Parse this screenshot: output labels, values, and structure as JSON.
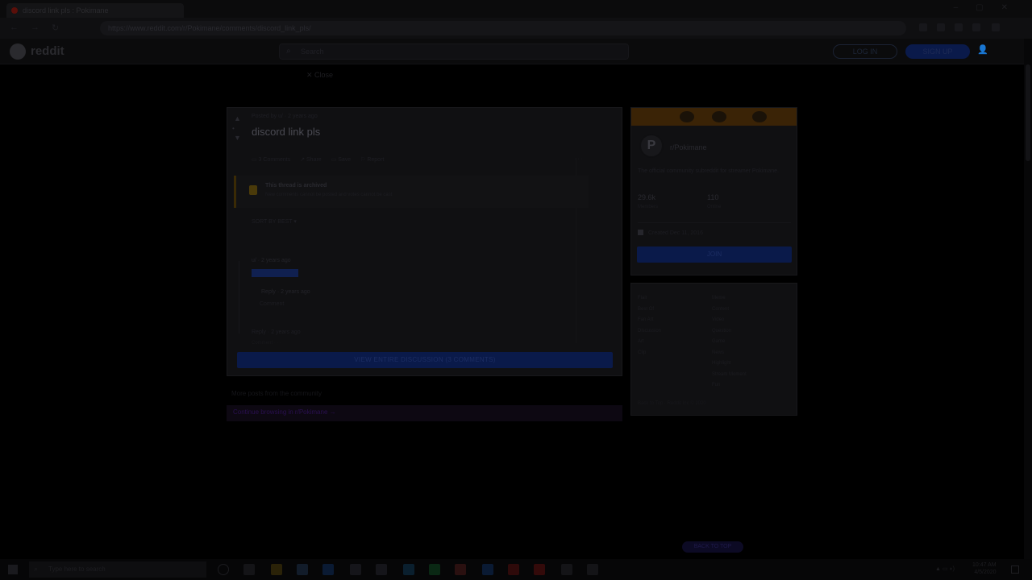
{
  "browser": {
    "tab_title": "discord link pls : Pokimane",
    "url": "https://www.reddit.com/r/Pokimane/comments/discord_link_pls/",
    "nav_back": "←",
    "nav_forward": "→",
    "nav_reload": "↻",
    "window_controls": "–▢✕"
  },
  "header": {
    "logo_text": "reddit",
    "search_placeholder": "Search",
    "login_label": "LOG IN",
    "signup_label": "SIGN UP",
    "user_icon": "👤"
  },
  "close_label": "✕ Close",
  "post": {
    "vote_up": "▲",
    "vote_count": "•",
    "vote_down": "▼",
    "meta": "Posted by u/ · 2 years ago",
    "title": "discord link pls",
    "actions": [
      "▭ 3 Comments",
      "↗ Share",
      "▭ Save",
      "⚐ Report"
    ],
    "sort_hint": "· · ·",
    "lock_title": "This thread is archived",
    "lock_sub": "New comments cannot be posted and votes cannot be cast",
    "sort_by": "SORT BY  BEST ▾",
    "comment1_author": "u/ · 2 years ago",
    "comment2_author": "Reply  · 2 years ago",
    "comment2_text": "Comment",
    "comment3_author": "Reply · 2 years ago",
    "comment3_sub": "Comment · · ·",
    "view_button": "VIEW ENTIRE DISCUSSION (3 COMMENTS)"
  },
  "more_label": "More posts from the community",
  "see_more_label": "Continue browsing in r/Pokimane →",
  "community": {
    "avatar_letter": "P",
    "name": "r/Pokimane",
    "description": "The official community subreddit for streamer Pokimane.",
    "members_value": "29.6k",
    "members_label": "Members",
    "online_value": "110",
    "online_label": "Online",
    "created": "Created Dec 11, 2016",
    "join_label": "JOIN"
  },
  "flair": {
    "col1": [
      "Flair",
      "Best Of",
      "Fan Art",
      "Discussion",
      "Art",
      "Clip"
    ],
    "col2": [
      "Meme",
      "Content",
      "Video",
      "Question",
      "Game",
      "News",
      "Highlight",
      "Stream Moment",
      "Fun"
    ],
    "footer": "Back to Top · Reddit Inc © 2020"
  },
  "back_to_top": "BACK TO TOP",
  "taskbar": {
    "search_placeholder": "Type here to search",
    "tray": "▲ ▭ ◗)",
    "time": "10:47 AM",
    "date": "4/5/2020"
  }
}
